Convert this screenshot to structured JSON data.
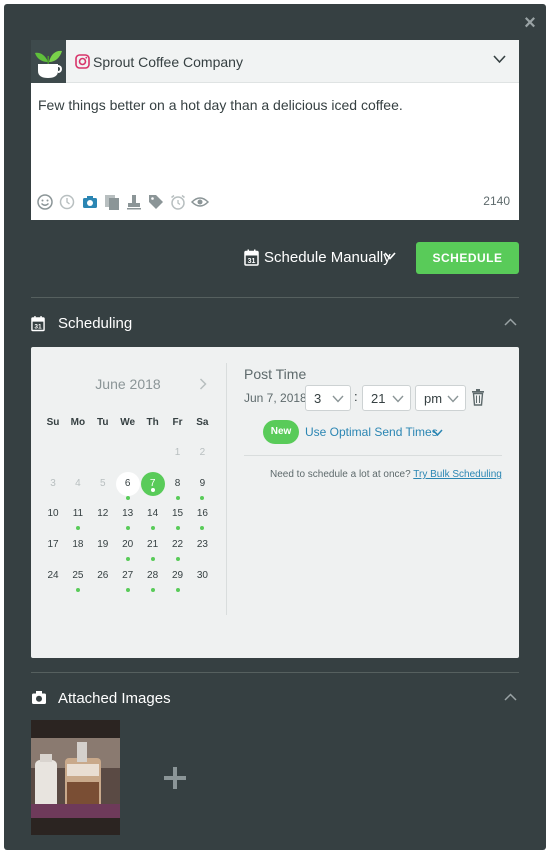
{
  "account": {
    "name": "Sprout Coffee Company",
    "network_icon": "instagram-icon",
    "avatar": "plant-coffee-cup-logo"
  },
  "composer": {
    "text": "Few things better on a hot day than a delicious iced coffee.",
    "char_count": "2140",
    "toolbar_icons": [
      "emoji-icon",
      "gif-icon",
      "camera-icon",
      "copy-icon",
      "stamp-icon",
      "tag-icon",
      "alarm-icon",
      "eye-icon"
    ]
  },
  "scheduling_bar": {
    "mode_label": "Schedule Manually",
    "schedule_button": "SCHEDULE"
  },
  "scheduling": {
    "title": "Scheduling",
    "calendar": {
      "month": "June 2018",
      "weekdays": [
        "Su",
        "Mo",
        "Tu",
        "We",
        "Th",
        "Fr",
        "Sa"
      ],
      "weeks": [
        [
          null,
          null,
          null,
          null,
          null,
          {
            "d": "1",
            "dim": true
          },
          {
            "d": "2",
            "dim": true
          }
        ],
        [
          {
            "d": "3",
            "dim": true
          },
          {
            "d": "4",
            "dim": true
          },
          {
            "d": "5",
            "dim": true
          },
          {
            "d": "6",
            "today": true,
            "dot": true
          },
          {
            "d": "7",
            "selected": true,
            "dot": true
          },
          {
            "d": "8",
            "dot": true
          },
          {
            "d": "9",
            "dot": true
          }
        ],
        [
          {
            "d": "10"
          },
          {
            "d": "11",
            "dot": true
          },
          {
            "d": "12"
          },
          {
            "d": "13",
            "dot": true
          },
          {
            "d": "14",
            "dot": true
          },
          {
            "d": "15",
            "dot": true
          },
          {
            "d": "16",
            "dot": true
          }
        ],
        [
          {
            "d": "17"
          },
          {
            "d": "18"
          },
          {
            "d": "19"
          },
          {
            "d": "20",
            "dot": true
          },
          {
            "d": "21",
            "dot": true
          },
          {
            "d": "22",
            "dot": true
          },
          {
            "d": "23"
          }
        ],
        [
          {
            "d": "24"
          },
          {
            "d": "25",
            "dot": true
          },
          {
            "d": "26"
          },
          {
            "d": "27",
            "dot": true
          },
          {
            "d": "28",
            "dot": true
          },
          {
            "d": "29",
            "dot": true
          },
          {
            "d": "30"
          }
        ]
      ]
    },
    "post_time": {
      "title": "Post Time",
      "date": "Jun 7, 2018",
      "hour": "3",
      "minute": "21",
      "meridiem": "pm",
      "new_badge": "New",
      "optimal_label": "Use Optimal Send Times",
      "bulk_text": "Need to schedule a lot at once?",
      "bulk_link": "Try Bulk Scheduling"
    }
  },
  "attached_images": {
    "title": "Attached Images",
    "items": [
      "iced-coffee-photo"
    ]
  },
  "colors": {
    "panel": "#364042",
    "accent_green": "#59cb59",
    "link_blue": "#2b86b3",
    "card_bg": "#eff1f1"
  }
}
